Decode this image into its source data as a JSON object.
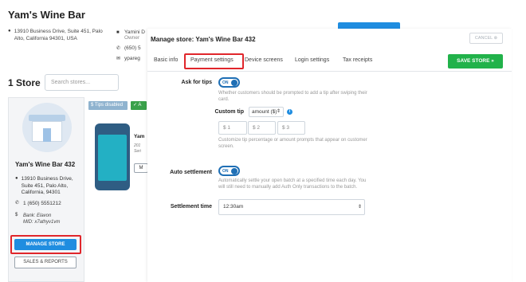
{
  "background": {
    "title": "Yam's Wine Bar",
    "address": "13910 Business Drive, Suite 451, Palo Alto, California 94301, USA",
    "owner_line": "Yamini D",
    "owner_sub": "Owner",
    "phone": "(650) 5",
    "email": "ypareg",
    "store_count": "1 Store",
    "search_placeholder": "Search stores...",
    "store": {
      "name": "Yam's Wine Bar 432",
      "address": "13910 Business Drive, Suite 451, Palo Alto, California, 94301",
      "phone": "1 (650) 5551212",
      "bank": "Bank: Elavon",
      "mid": "MID: x7athyv1vm",
      "manage_label": "MANAGE STORE",
      "sales_label": "SALES & REPORTS"
    },
    "badges": {
      "tips": "$ Tips disabled",
      "active": "✓ A"
    },
    "device": {
      "name": "Yam",
      "sub_1": "201",
      "sub_2": "Seri",
      "btn": "M"
    }
  },
  "modal": {
    "title": "Manage store: Yam's Wine Bar 432",
    "cancel_label": "CANCEL ⊗",
    "save_label": "SAVE STORE »",
    "tabs": [
      {
        "label": "Basic info",
        "active": false
      },
      {
        "label": "Payment settings",
        "active": true
      },
      {
        "label": "Device screens",
        "active": false
      },
      {
        "label": "Login settings",
        "active": false
      },
      {
        "label": "Tax receipts",
        "active": false
      }
    ],
    "ask_for_tips": {
      "label": "Ask for tips",
      "toggle": "ON",
      "help": "Whether customers should be prompted to add a tip after swiping their card."
    },
    "custom_tip": {
      "label": "Custom tip",
      "mode": "amount ($)",
      "inputs": [
        "$ 1",
        "$ 2",
        "$ 3"
      ],
      "help": "Customize tip percentage or amount prompts that appear on customer screen."
    },
    "auto_settlement": {
      "label": "Auto settlement",
      "toggle": "ON",
      "help": "Automatically settle your open batch at a specified time each day. You will still need to manually add Auth Only transactions to the batch."
    },
    "settlement_time": {
      "label": "Settlement time",
      "value": "12:30am"
    },
    "colors": {
      "primary": "#1f8de0",
      "save": "#21b24a",
      "highlight": "#e0262b"
    }
  }
}
